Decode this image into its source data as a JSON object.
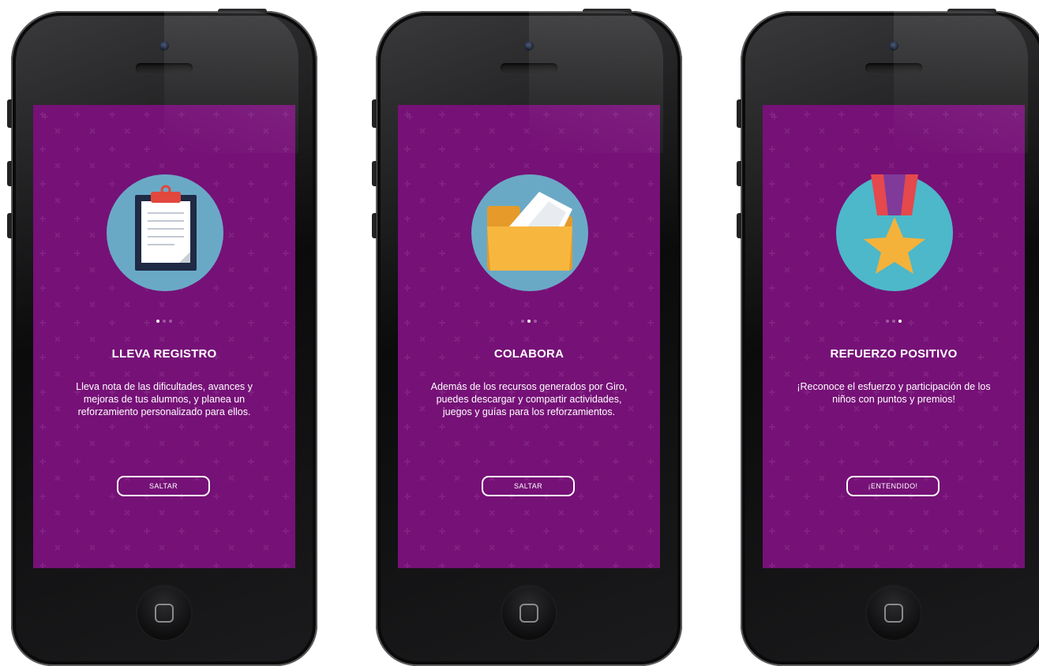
{
  "colors": {
    "screen_bg": "#761177",
    "circle_blue": "#6aa9c6",
    "circle_teal": "#4db8c9",
    "folder": "#f7b73f",
    "clipboard_dark": "#1f2a44",
    "clip_red": "#e1473d",
    "ribbon_red": "#e5484d",
    "ribbon_purple": "#7f3a9a",
    "star": "#f4b23a"
  },
  "screens": [
    {
      "illustration_icon": "clipboard-icon",
      "active_dot": 0,
      "title": "LLEVA REGISTRO",
      "description": "Lleva nota de las dificultades, avances y mejoras de tus alumnos, y planea un reforzamiento personalizado para ellos.",
      "button": "SALTAR"
    },
    {
      "illustration_icon": "folder-icon",
      "active_dot": 1,
      "title": "COLABORA",
      "description": "Además de los recursos generados por Giro, puedes descargar y compartir actividades, juegos y guías para los reforzamientos.",
      "button": "SALTAR"
    },
    {
      "illustration_icon": "medal-icon",
      "active_dot": 2,
      "title": "REFUERZO POSITIVO",
      "description": "¡Reconoce el esfuerzo y participación de los niños con puntos y premios!",
      "button": "¡ENTENDIDO!"
    }
  ]
}
